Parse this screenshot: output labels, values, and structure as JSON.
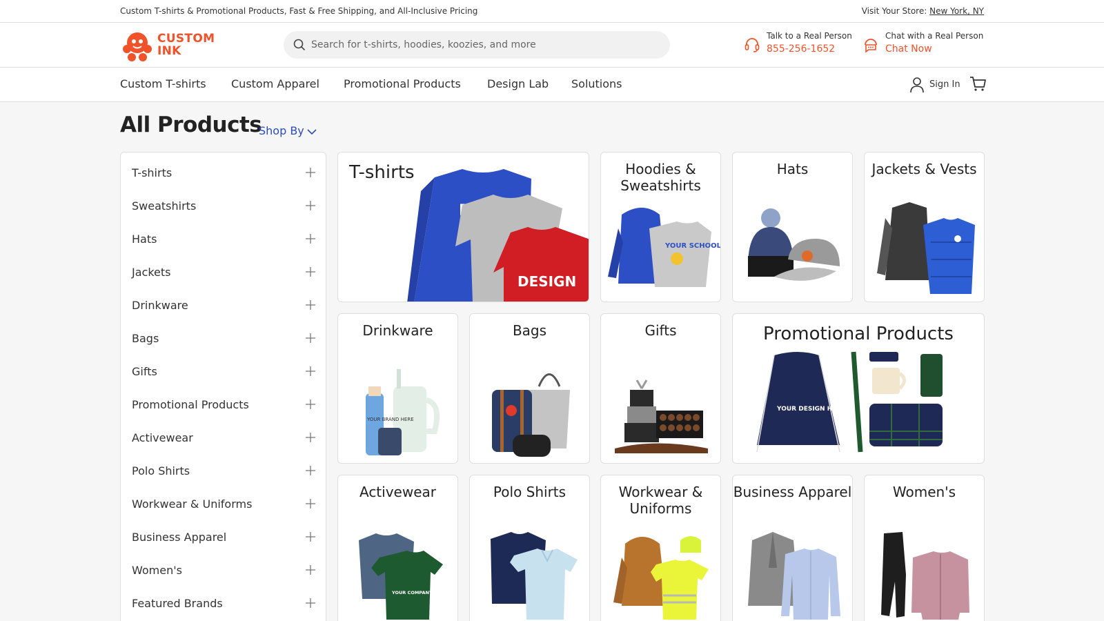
{
  "topbar": {
    "promo": "Custom T-shirts & Promotional Products, Fast & Free Shipping, and All-Inclusive Pricing",
    "store_prefix": "Visit Your Store:",
    "store_link": "New York, NY"
  },
  "header": {
    "logo_line1": "CUSTOM",
    "logo_line2": "INK",
    "search_placeholder": "Search for t-shirts, hoodies, koozies, and more",
    "phone": {
      "label": "Talk to a Real Person",
      "value": "855-256-1652",
      "icon": "headset-icon"
    },
    "chat": {
      "label": "Chat with a Real Person",
      "value": "Chat Now",
      "icon": "chat-icon"
    }
  },
  "nav": {
    "items": [
      "Custom T-shirts",
      "Custom Apparel",
      "Promotional Products",
      "Design Lab",
      "Solutions"
    ],
    "signin": "Sign In"
  },
  "page": {
    "title": "All Products",
    "shop_by": "Shop By"
  },
  "sidebar": {
    "items": [
      "T-shirts",
      "Sweatshirts",
      "Hats",
      "Jackets",
      "Drinkware",
      "Bags",
      "Gifts",
      "Promotional Products",
      "Activewear",
      "Polo Shirts",
      "Workwear & Uniforms",
      "Business Apparel",
      "Women's",
      "Featured Brands"
    ]
  },
  "cards": {
    "tshirts": "T-shirts",
    "hoodies": "Hoodies & Sweatshirts",
    "hats": "Hats",
    "jackets": "Jackets & Vests",
    "drinkware": "Drinkware",
    "bags": "Bags",
    "gifts": "Gifts",
    "promo": "Promotional Products",
    "activewear": "Activewear",
    "polo": "Polo Shirts",
    "workwear": "Workwear & Uniforms",
    "business": "Business Apparel",
    "womens": "Women's"
  },
  "art_text": {
    "your_design_here": "YOUR DESIGN HERE",
    "design": "DESIGN",
    "your_school": "YOUR SCHOOL",
    "your_brand_here": "YOUR BRAND HERE",
    "your_company": "YOUR COMPANY"
  },
  "colors": {
    "accent": "#f0522a",
    "link": "#2a4db8"
  }
}
